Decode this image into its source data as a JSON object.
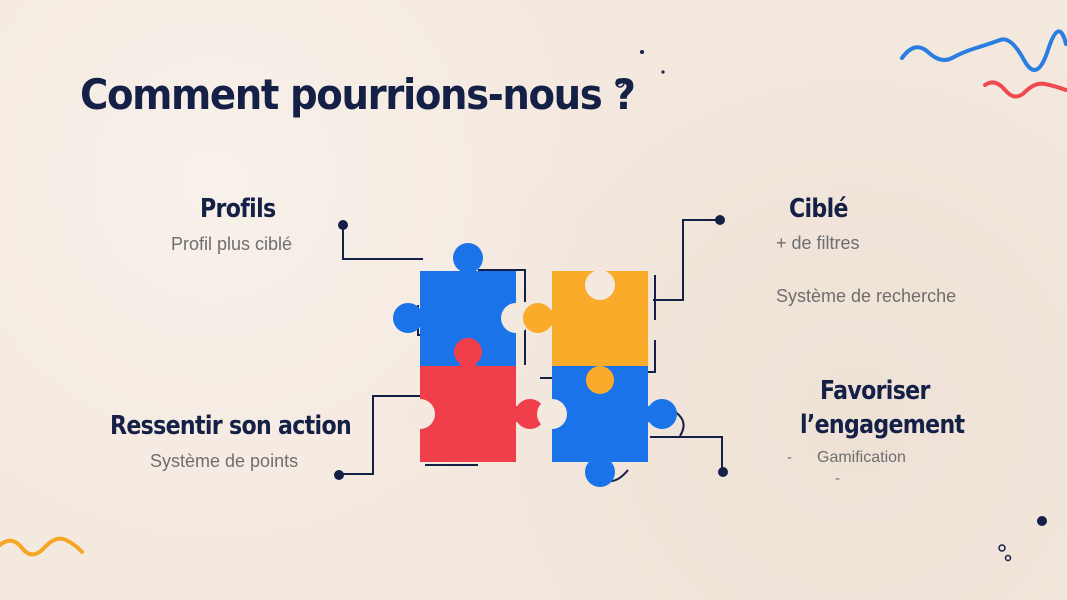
{
  "slide": {
    "title": "Comment pourrions-nous ?",
    "profils": {
      "heading": "Profils",
      "detail": "Profil plus ciblé"
    },
    "cible": {
      "heading": "Ciblé",
      "details": [
        "+ de filtres",
        "Système de recherche"
      ]
    },
    "ressentir": {
      "heading": "Ressentir son action",
      "detail": "Système de points"
    },
    "engagement": {
      "heading_line1": "Favoriser",
      "heading_line2": "l’engagement",
      "bullet_marker": "-",
      "bullet_item": "Gamification",
      "bullet_marker2": "-"
    }
  },
  "colors": {
    "background": "#f4e9df",
    "navy": "#152047",
    "blue": "#1a73e8",
    "yellow": "#f9ab29",
    "red": "#f03e4a",
    "wave_blue": "#2a7de1",
    "wave_red": "#ef4a50",
    "wave_orange": "#f5a623"
  },
  "icons": [
    "puzzle-icon",
    "squiggle-decoration",
    "dot-decoration"
  ]
}
